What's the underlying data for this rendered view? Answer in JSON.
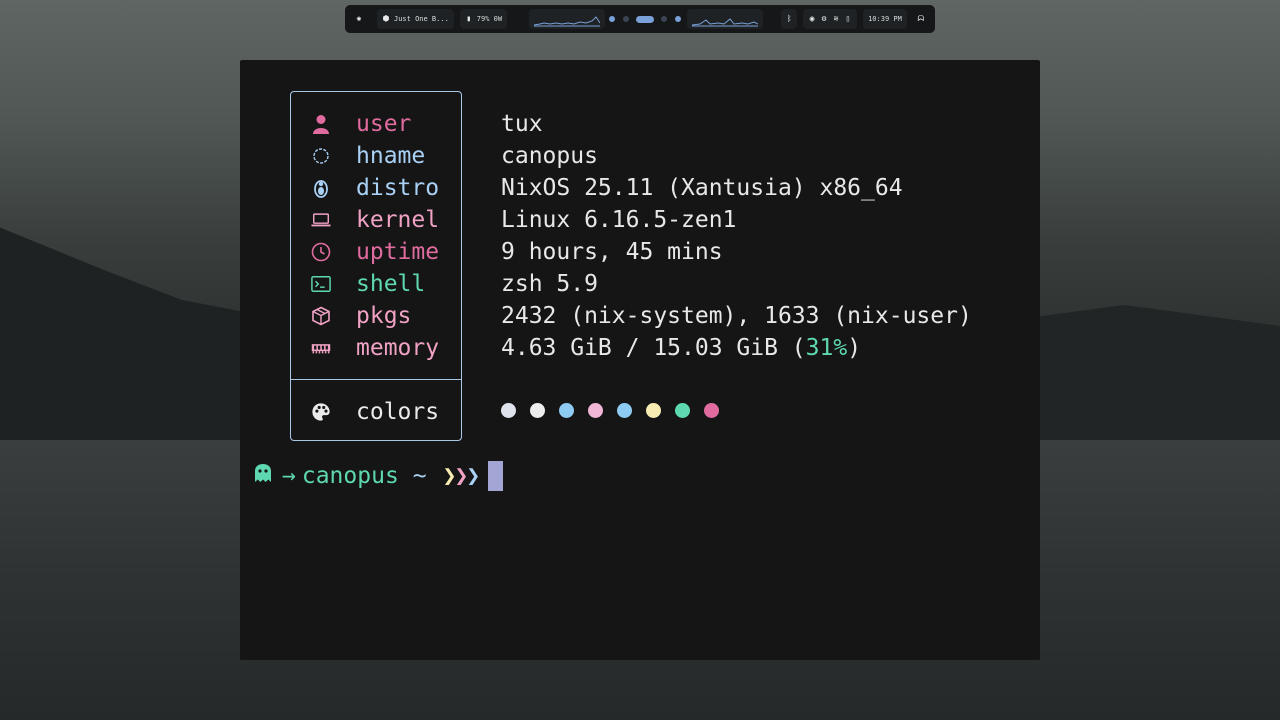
{
  "topbar": {
    "window_title": "Just One B...",
    "battery": "79% 0W",
    "clock": "10:39 PM"
  },
  "terminal": {
    "rows": [
      {
        "label": "user",
        "value": "tux",
        "icon": "user-icon",
        "label_color": "#e06c9f"
      },
      {
        "label": "hname",
        "value": "canopus",
        "icon": "hostname-icon",
        "label_color": "#a9d1f5"
      },
      {
        "label": "distro",
        "value": "NixOS 25.11 (Xantusia) x86_64",
        "icon": "linux-penguin-icon",
        "label_color": "#a9d1f5"
      },
      {
        "label": "kernel",
        "value": "Linux 6.16.5-zen1",
        "icon": "laptop-icon",
        "label_color": "#f0a2c4"
      },
      {
        "label": "uptime",
        "value": "9 hours, 45 mins",
        "icon": "clock-icon",
        "label_color": "#e06c9f"
      },
      {
        "label": "shell",
        "value": "zsh 5.9",
        "icon": "terminal-icon",
        "label_color": "#5ed8b0"
      },
      {
        "label": "pkgs",
        "value": "2432 (nix-system), 1633 (nix-user)",
        "icon": "package-icon",
        "label_color": "#f0a2c4"
      },
      {
        "label": "memory",
        "value_prefix": "4.63 GiB / 15.03 GiB (",
        "value_percent": "31%",
        "value_suffix": ")",
        "icon": "memory-icon",
        "label_color": "#f0a2c4"
      }
    ],
    "colors_label": "colors",
    "swatches": [
      "#dfe3ec",
      "#eeeeee",
      "#8ecbf2",
      "#f2b6d6",
      "#8ecbf2",
      "#f8ecb2",
      "#5ed8b0",
      "#e06c9f"
    ],
    "prompt": {
      "arrow": "→",
      "host": "canopus",
      "dir": "~",
      "chevrons": "❯❯❯"
    }
  }
}
